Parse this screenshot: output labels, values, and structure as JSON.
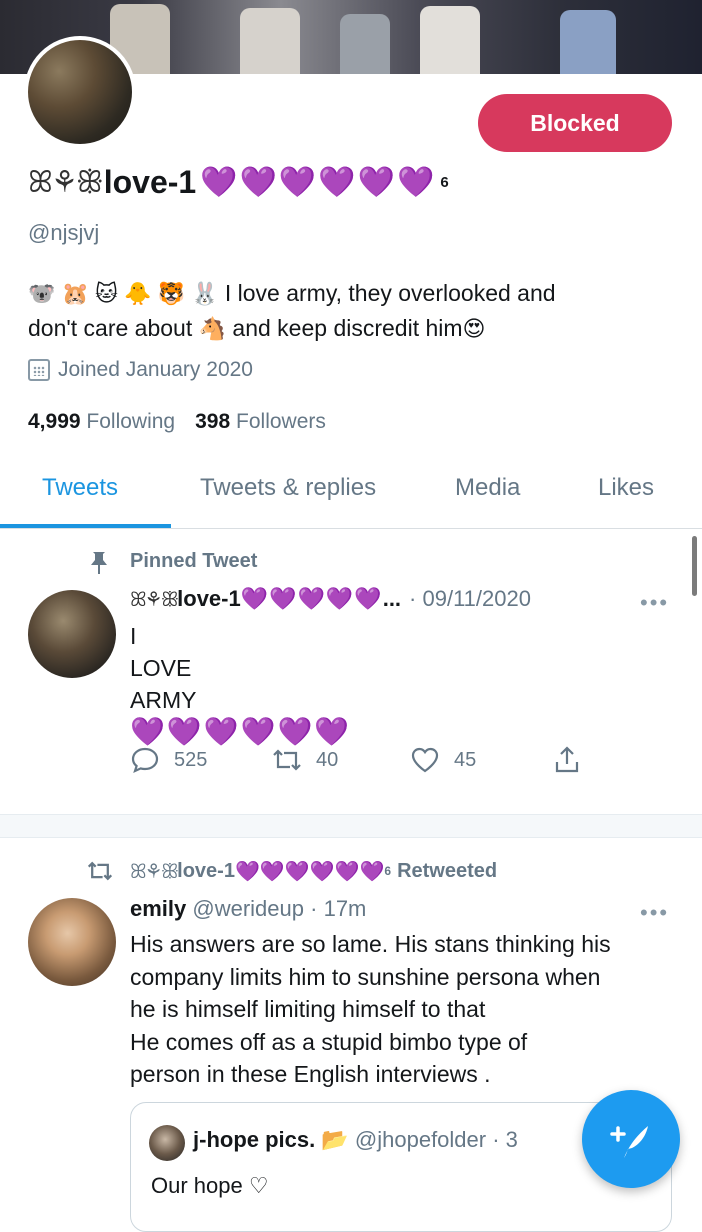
{
  "profile": {
    "blocked_label": "Blocked",
    "name_prefix_glyphs": "ꕤ⚘ꕥ",
    "display_name": "love-1",
    "name_hearts": "💜💜💜💜💜💜",
    "name_superscript": "6",
    "handle": "@njsjvj",
    "bio_emojis": "🐨 🐹 🐱 🐥 🐯 🐰",
    "bio_text_1": "I love army, they overlooked and",
    "bio_text_2": "don't care about",
    "bio_emoji_horse": "🐴",
    "bio_text_3": "and keep discredit him",
    "bio_emoji_end": "😍",
    "joined": "Joined January 2020",
    "following_count": "4,999",
    "following_label": "Following",
    "followers_count": "398",
    "followers_label": "Followers"
  },
  "tabs": [
    {
      "label": "Tweets",
      "active": true
    },
    {
      "label": "Tweets & replies",
      "active": false
    },
    {
      "label": "Media",
      "active": false
    },
    {
      "label": "Likes",
      "active": false
    }
  ],
  "pinned_tweet": {
    "pinned_label": "Pinned Tweet",
    "author_prefix": "ꕤ⚘ꕥ",
    "author_name": "love-1",
    "author_hearts": "💜💜💜💜💜",
    "ellipsis": "...",
    "date": "· 09/11/2020",
    "more": "•••",
    "lines": [
      "I",
      "LOVE",
      "ARMY"
    ],
    "hearts": "💜💜💜💜💜💜",
    "replies": "525",
    "retweets": "40",
    "likes": "45"
  },
  "retweet": {
    "rt_prefix": "ꕤ⚘ꕥ",
    "rt_name": "love-1",
    "rt_hearts": "💜💜💜💜💜💜",
    "rt_sup": "6",
    "rt_label": "Retweeted",
    "author_name": "emily",
    "author_handle": "@werideup",
    "time": "· 17m",
    "more": "•••",
    "text_lines": [
      "His answers are so lame. His stans thinking his",
      "company limits him to sunshine persona when",
      "he is himself limiting himself to that",
      "He comes off as a stupid bimbo type of",
      "person in these English interviews ."
    ],
    "quote": {
      "name": "j-hope pics.",
      "folder_glyph": "📂",
      "handle": "@jhopefolder",
      "time": "· 3",
      "text": "Our hope ♡"
    }
  },
  "colors": {
    "blocked": "#d7395d",
    "accent": "#1b95e0",
    "heart_purple": "#8c39d6",
    "muted": "#657786"
  }
}
